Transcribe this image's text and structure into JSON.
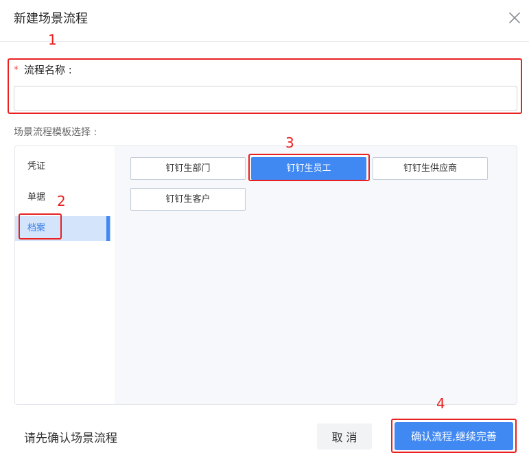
{
  "dialog": {
    "title": "新建场景流程"
  },
  "form": {
    "required_mark": "*",
    "name_label": "流程名称 :",
    "name_value": "",
    "name_placeholder": "",
    "template_label": "场景流程模板选择 :"
  },
  "sidebar": {
    "items": [
      {
        "label": "凭证",
        "active": false
      },
      {
        "label": "单据",
        "active": false
      },
      {
        "label": "档案",
        "active": true
      }
    ]
  },
  "templates": [
    {
      "label": "钉钉生部门",
      "selected": false
    },
    {
      "label": "钉钉生员工",
      "selected": true
    },
    {
      "label": "钉钉生供应商",
      "selected": false
    },
    {
      "label": "钉钉生客户",
      "selected": false
    }
  ],
  "footer": {
    "hint": "请先确认场景流程",
    "cancel_label": "取 消",
    "confirm_label": "确认流程,继续完善"
  },
  "annotations": [
    "1",
    "2",
    "3",
    "4"
  ],
  "colors": {
    "primary": "#4189f2",
    "annotation": "#e8201f",
    "active_bg": "#d3e4fb"
  },
  "icons": {
    "close": "close-icon"
  }
}
